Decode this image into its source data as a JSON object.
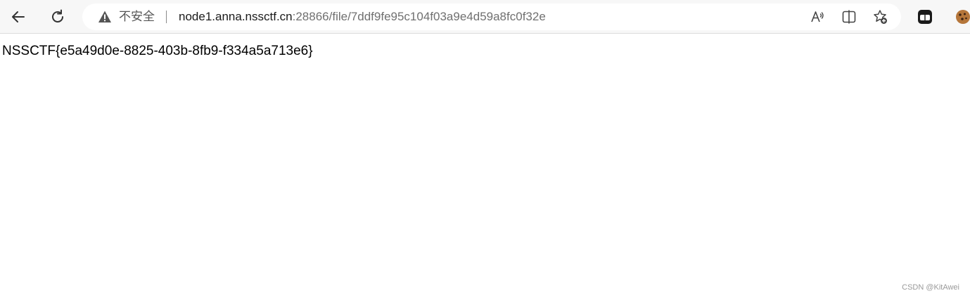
{
  "browser": {
    "security_label": "不安全",
    "url_host": "node1.anna.nssctf.cn",
    "url_rest": ":28866/file/7ddf9fe95c104f03a9e4d59a8fc0f32e",
    "icons": {
      "back": "back-arrow-icon",
      "refresh": "refresh-icon",
      "warning": "warning-icon",
      "read_aloud": "read-aloud-icon",
      "split_screen": "split-screen-icon",
      "add_favorite": "add-favorite-icon",
      "extension": "extension-icon",
      "cookie": "cookie-extension-icon"
    }
  },
  "page": {
    "content": "NSSCTF{e5a49d0e-8825-403b-8fb9-f334a5a713e6}"
  },
  "watermark": "CSDN @KitAwei"
}
